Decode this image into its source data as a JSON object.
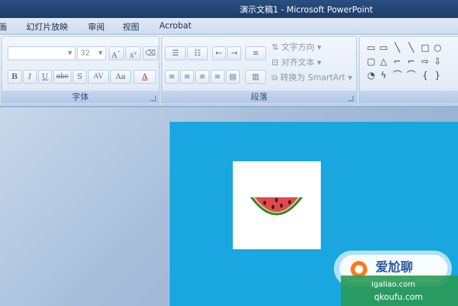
{
  "window": {
    "title": "演示文稿1 - Microsoft PowerPoint"
  },
  "menu": {
    "items": [
      "画",
      "幻灯片放映",
      "审阅",
      "视图",
      "Acrobat"
    ]
  },
  "font_group": {
    "label": "字体",
    "font_name_value": "",
    "font_size_value": "32",
    "bold": "B",
    "italic": "I",
    "underline": "U",
    "strike": "abc",
    "shadow": "S",
    "spacing": "AV",
    "case": "Aa",
    "grow": "A",
    "shrink": "A",
    "color": "A"
  },
  "paragraph_group": {
    "label": "段落",
    "text_direction": "文字方向",
    "align_text": "对齐文本",
    "smartart": "转换为 SmartArt"
  },
  "drawing_group": {
    "shapes": [
      "▭",
      "▭",
      "╲",
      "╲",
      "□",
      "○",
      "▢",
      "△",
      "⌐",
      "⌐",
      "⇨",
      "⇩",
      "◔",
      "ϟ",
      "⌒",
      "⌒",
      "{",
      "}"
    ]
  },
  "slide": {
    "background_color": "#1aa7df",
    "image_card_color": "#ffffff"
  },
  "watermark": {
    "line1": "爱尬聊",
    "line2": "igaliao.com",
    "line3": "qkoufu.com"
  },
  "colors": {
    "title_bar": "#1d3c68",
    "ribbon": "#dbe6f4",
    "slide": "#1aa7df"
  }
}
